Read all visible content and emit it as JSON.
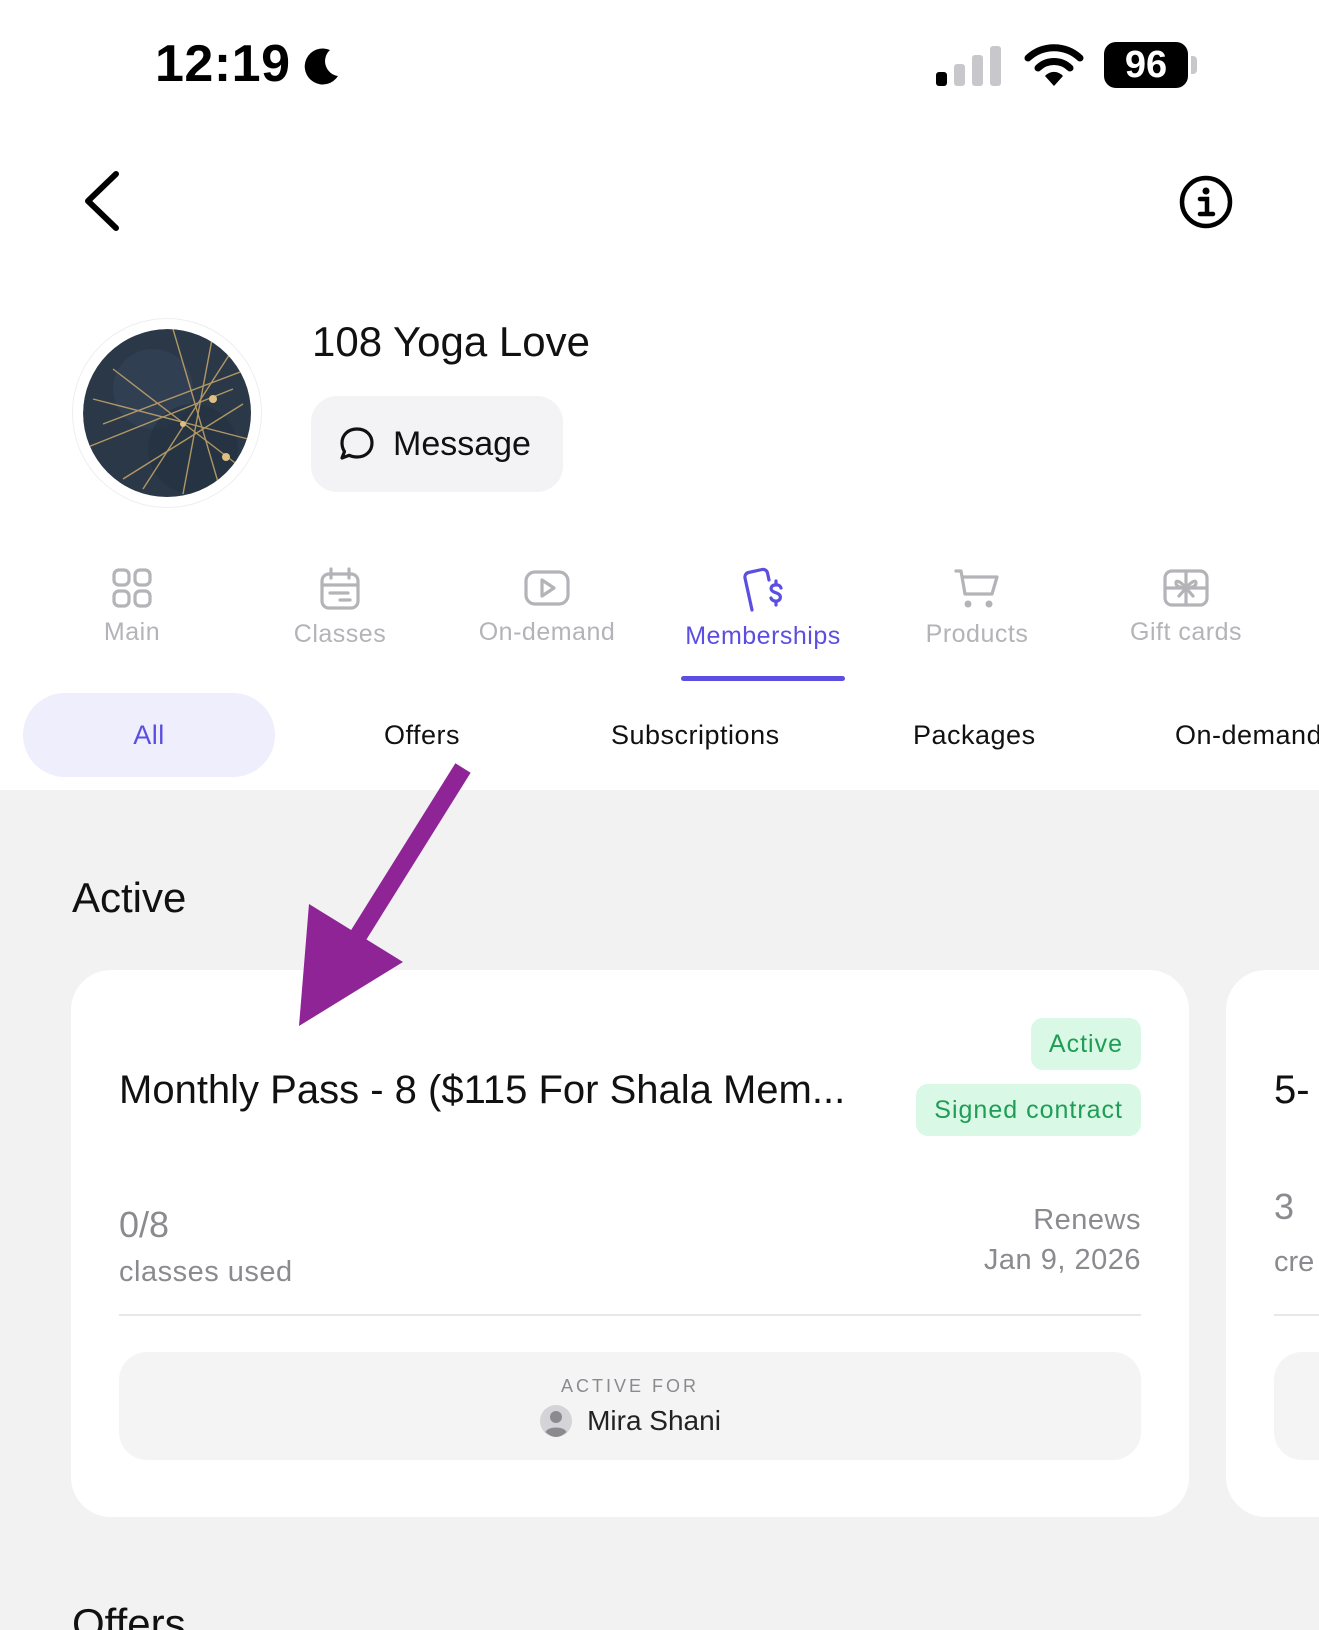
{
  "status_bar": {
    "time": "12:19",
    "battery": "96",
    "moon_icon": "moon-icon",
    "signal_icon": "cellular-signal-icon",
    "wifi_icon": "wifi-icon"
  },
  "nav": {
    "back_icon": "chevron-left-icon",
    "info_icon": "info-icon"
  },
  "studio": {
    "name": "108 Yoga Love",
    "message_label": "Message"
  },
  "main_tabs": [
    {
      "label": "Main",
      "icon": "grid-icon",
      "active": false
    },
    {
      "label": "Classes",
      "icon": "calendar-icon",
      "active": false
    },
    {
      "label": "On-demand",
      "icon": "play-icon",
      "active": false
    },
    {
      "label": "Memberships",
      "icon": "membership-dollar-icon",
      "active": true
    },
    {
      "label": "Products",
      "icon": "cart-icon",
      "active": false
    },
    {
      "label": "Gift cards",
      "icon": "gift-card-icon",
      "active": false
    }
  ],
  "filters": [
    {
      "label": "All",
      "selected": true
    },
    {
      "label": "Offers",
      "selected": false
    },
    {
      "label": "Subscriptions",
      "selected": false
    },
    {
      "label": "Packages",
      "selected": false
    },
    {
      "label": "On-demand",
      "selected": false
    }
  ],
  "sections": {
    "active_title": "Active",
    "offers_title": "Offers"
  },
  "membership_card": {
    "title": "Monthly Pass - 8 ($115 For Shala Mem...",
    "badge_active": "Active",
    "badge_signed": "Signed contract",
    "used_count": "0/8",
    "used_label": "classes used",
    "renews_label": "Renews",
    "renews_date": "Jan 9, 2026",
    "active_for_label": "ACTIVE FOR",
    "active_for_user": "Mira Shani"
  },
  "second_card": {
    "title": "5-",
    "count": "3",
    "label": "cre"
  },
  "colors": {
    "accent": "#5b4ee0",
    "badge_bg": "#d9f8e6",
    "badge_text": "#1f9d55",
    "annotation_arrow": "#8e2496"
  }
}
